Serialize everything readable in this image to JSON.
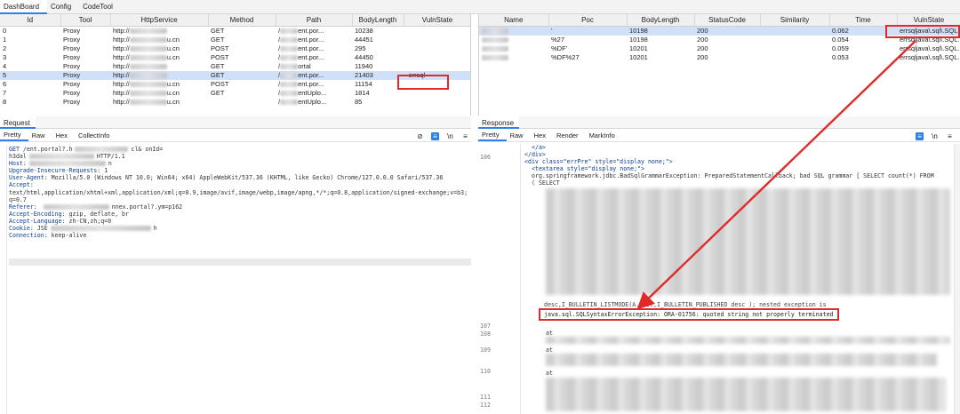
{
  "topbar": {
    "tabs": [
      "DashBoard",
      "Config",
      "CodeTool"
    ]
  },
  "left_table": {
    "headers": [
      "Id",
      "Tool",
      "HttpService",
      "Method",
      "Path",
      "BodyLength",
      "VulnState"
    ],
    "rows": [
      {
        "id": "0",
        "tool": "Proxy",
        "http": "http://",
        "http_tail": "",
        "method": "GET",
        "path": "/",
        "path_tail": "ent.por...",
        "len": "10238",
        "vuln": ""
      },
      {
        "id": "1",
        "tool": "Proxy",
        "http": "http://",
        "http_tail": "u.cn",
        "method": "GET",
        "path": "/",
        "path_tail": "ent.por...",
        "len": "44451",
        "vuln": ""
      },
      {
        "id": "2",
        "tool": "Proxy",
        "http": "http://",
        "http_tail": "u.cn",
        "method": "POST",
        "path": "/",
        "path_tail": "ent.por...",
        "len": "295",
        "vuln": ""
      },
      {
        "id": "3",
        "tool": "Proxy",
        "http": "http://",
        "http_tail": "u.cn",
        "method": "POST",
        "path": "/",
        "path_tail": "ent.por...",
        "len": "44450",
        "vuln": ""
      },
      {
        "id": "4",
        "tool": "Proxy",
        "http": "http://",
        "http_tail": "",
        "method": "GET",
        "path": "/",
        "path_tail": "ortal",
        "len": "11940",
        "vuln": ""
      },
      {
        "id": "5",
        "tool": "Proxy",
        "http": "http://",
        "http_tail": "",
        "method": "GET",
        "path": "/",
        "path_tail": "ent.por...",
        "len": "21403",
        "vuln": "-errsql"
      },
      {
        "id": "6",
        "tool": "Proxy",
        "http": "http://",
        "http_tail": "u.cn",
        "method": "POST",
        "path": "/",
        "path_tail": "ent.por...",
        "len": "11154",
        "vuln": ""
      },
      {
        "id": "7",
        "tool": "Proxy",
        "http": "http://",
        "http_tail": "u.cn",
        "method": "GET",
        "path": "/",
        "path_tail": "entUplo...",
        "len": "1814",
        "vuln": ""
      },
      {
        "id": "8",
        "tool": "Proxy",
        "http": "http://",
        "http_tail": "u.cn",
        "method": "",
        "path": "/",
        "path_tail": "entUplo...",
        "len": "85",
        "vuln": ""
      }
    ]
  },
  "right_table": {
    "headers": [
      "Name",
      "Poc",
      "BodyLength",
      "StatusCode",
      "Similarity",
      "Time",
      "VulnState"
    ],
    "rows": [
      {
        "name": "",
        "poc": "'",
        "len": "10198",
        "status": "200",
        "sim": "",
        "time": "0.062",
        "vuln": "errsqljava\\.sql\\.SQL..."
      },
      {
        "name": "",
        "poc": "%27",
        "len": "10198",
        "status": "200",
        "sim": "",
        "time": "0.054",
        "vuln": "errsqljava\\.sql\\.SQL..."
      },
      {
        "name": "",
        "poc": "%DF'",
        "len": "10201",
        "status": "200",
        "sim": "",
        "time": "0.059",
        "vuln": "errsqljava\\.sql\\.SQL..."
      },
      {
        "name": "",
        "poc": "%DF%27",
        "len": "10201",
        "status": "200",
        "sim": "",
        "time": "0.053",
        "vuln": "errsqljava\\.sql\\.SQL..."
      }
    ]
  },
  "request": {
    "title": "Request",
    "tabs": [
      "Pretty",
      "Raw",
      "Hex",
      "CollectInfo"
    ],
    "lines": [
      {
        "k": "GET /",
        "v": "ent.portal?.h",
        "tail": "cl&                  onId="
      },
      {
        "k": "",
        "v": "h3dal",
        "tail": "HTTP/1.1"
      },
      {
        "k": "Host",
        "v": ":",
        "tail": "n"
      },
      {
        "k": "Upgrade-Insecure-Requests",
        "v": ": 1",
        "tail": ""
      },
      {
        "k": "User-Agent",
        "v": ": Mozilla/5.0 (Windows NT 10.0; Win64; x64) AppleWebKit/537.36 (KHTML, like Gecko) Chrome/127.0.0.0 Safari/537.36",
        "tail": ""
      },
      {
        "k": "Accept",
        "v": ":",
        "tail": ""
      },
      {
        "k": "",
        "v": "text/html,application/xhtml+xml,application/xml;q=0.9,image/avif,image/webp,image/apng,*/*;q=0.8,application/signed-exchange;v=b3;",
        "tail": ""
      },
      {
        "k": "",
        "v": "q=0.7",
        "tail": ""
      },
      {
        "k": "Referer",
        "v": ": ",
        "tail": "nnex.portal?.ym=p162"
      },
      {
        "k": "Accept-Encoding",
        "v": ": gzip, deflate, br",
        "tail": ""
      },
      {
        "k": "Accept-Language",
        "v": ": zh-CN,zh;q=0",
        "tail": ""
      },
      {
        "k": "Cookie",
        "v": ": JSE",
        "tail": "h"
      },
      {
        "k": "Connection",
        "v": ": keep-alive",
        "tail": ""
      }
    ]
  },
  "response": {
    "title": "Response",
    "tabs": [
      "Pretty",
      "Raw",
      "Hex",
      "Render",
      "MarkInfo"
    ],
    "gutter": [
      "106",
      "107",
      "108",
      "109",
      "110",
      "111",
      "112"
    ],
    "line_close_a": "</a>",
    "line_close_div": "</div>",
    "div_open": "<div class=\"errPre\" style=\"display none;\">",
    "textarea_open": "<textarea style=\"display none;\">",
    "err1": "org.springframework.jdbc.BadSqlGrammarException: PreparedStatementCallback; bad SQL grammar [ SELECT count(*) FROM",
    "err2": "( SELECT",
    "err3": "desc,I_BULLETIN_LISTMODE(A.desc,I_BULLETIN_PUBLISHED desc ); nested exception is",
    "error_line": "java.sql.SQLSyntaxErrorException: ORA-01756: quoted string not properly terminated",
    "at": "at"
  },
  "colors": {
    "accent": "#2f80ed",
    "highlight": "#e02a2a",
    "selected_row": "#cfe0f7"
  },
  "icons": [
    "eye-off-icon",
    "wrap-icon",
    "newline-icon",
    "menu-icon"
  ]
}
